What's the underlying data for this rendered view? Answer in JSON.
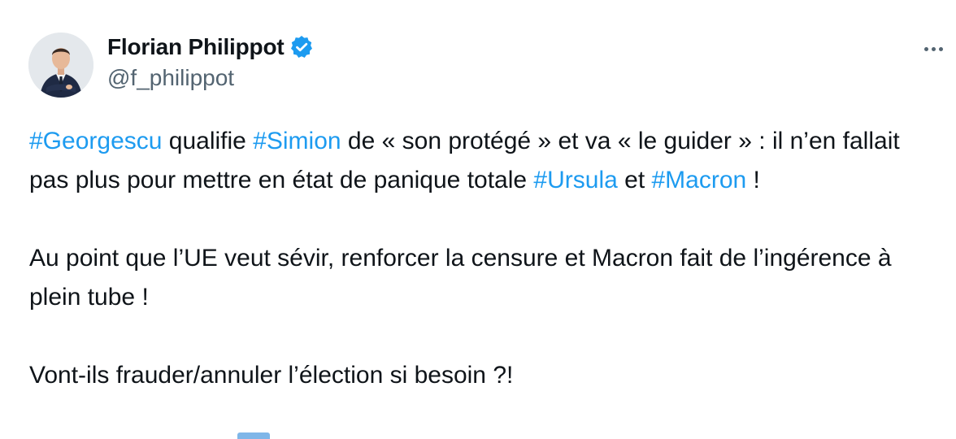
{
  "author": {
    "name": "Florian Philippot",
    "handle": "@f_philippot",
    "verified": true
  },
  "tweet": {
    "p1": {
      "t1": "#Georgescu",
      "t2": " qualifie ",
      "t3": "#Simion",
      "t4": " de « son protégé » et va « le guider » : il n’en fallait pas plus pour mettre en état de panique totale ",
      "t5": "#Ursula",
      "t6": " et ",
      "t7": "#Macron",
      "t8": " !"
    },
    "p2": "Au point que l’UE veut sévir, renforcer la censure et Macron fait de l’ingérence à plein tube !",
    "p3": "Vont-ils frauder/annuler l’élection si besoin ?!"
  },
  "colors": {
    "text": "#0f1419",
    "secondary": "#536471",
    "link": "#1d9bf0",
    "verified_badge": "#1d9bf0"
  },
  "icons": {
    "verified": "verified-badge-icon",
    "more": "more-options-icon"
  }
}
